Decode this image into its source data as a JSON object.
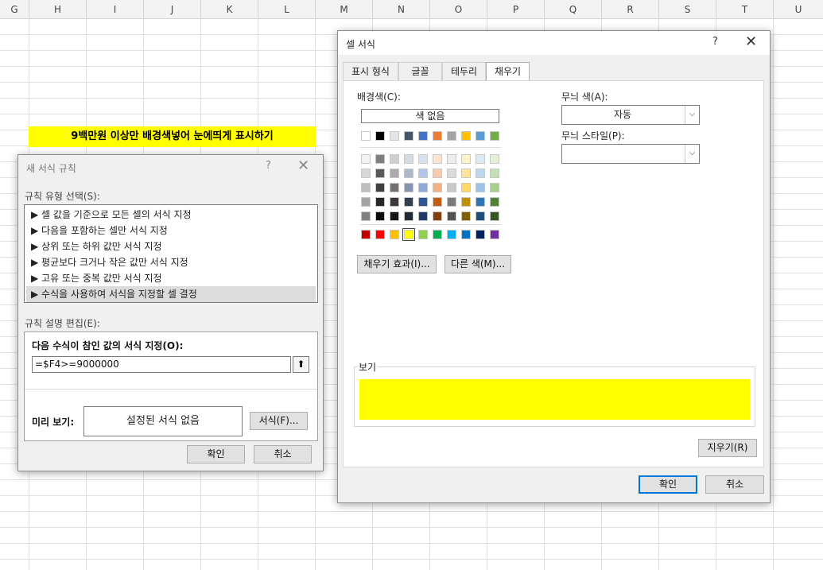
{
  "sheet": {
    "columns": [
      "G",
      "H",
      "I",
      "J",
      "K",
      "L",
      "M",
      "N",
      "O",
      "P",
      "Q",
      "R",
      "S",
      "T",
      "U"
    ],
    "banner_text": "9백만원 이상만 배경색넣어 눈에띄게 표시하기",
    "banner_color": "#ffff00"
  },
  "rule_dialog": {
    "title": "새 서식 규칙",
    "help": "?",
    "close": "✕",
    "select_type_label": "규칙 유형 선택(S):",
    "rule_types": [
      "▶ 셀 값을 기준으로 모든 셀의 서식 지정",
      "▶ 다음을 포함하는 셀만 서식 지정",
      "▶ 상위 또는 하위 값만 서식 지정",
      "▶ 평균보다 크거나 작은 값만 서식 지정",
      "▶ 고유 또는 중복 값만 서식 지정",
      "▶ 수식을 사용하여 서식을 지정할 셀 결정"
    ],
    "edit_label": "규칙 설명 편집(E):",
    "formula_label": "다음 수식이 참인 값의 서식 지정(O):",
    "formula_value": "=$F4>=9000000",
    "upload_icon": "⬆",
    "preview_label": "미리 보기:",
    "preview_text": "설정된 서식 없음",
    "format_button": "서식(F)...",
    "ok": "확인",
    "cancel": "취소"
  },
  "format_dialog": {
    "title": "셀 서식",
    "help": "?",
    "close": "✕",
    "tabs": [
      "표시 형식",
      "글꼴",
      "테두리",
      "채우기"
    ],
    "active_tab": "채우기",
    "bg_color_label": "배경색(C):",
    "no_color": "색 없음",
    "theme_colors_top": [
      "#ffffff",
      "#000000",
      "#e7e6e6",
      "#44546a",
      "#4472c4",
      "#ed7d31",
      "#a5a5a5",
      "#ffc000",
      "#5b9bd5",
      "#70ad47"
    ],
    "theme_shades": [
      [
        "#f2f2f2",
        "#7f7f7f",
        "#d0cece",
        "#d6dce4",
        "#d9e2f3",
        "#fbe5d5",
        "#ededed",
        "#fff2cc",
        "#deebf6",
        "#e2efd9"
      ],
      [
        "#d8d8d8",
        "#595959",
        "#aeabab",
        "#adb9ca",
        "#b4c6e7",
        "#f7cbac",
        "#dbdbdb",
        "#fee599",
        "#bdd7ee",
        "#c5e0b3"
      ],
      [
        "#bfbfbf",
        "#3f3f3f",
        "#757070",
        "#8496b0",
        "#8eaadb",
        "#f4b183",
        "#c9c9c9",
        "#ffd965",
        "#9dc3e6",
        "#a8d08d"
      ],
      [
        "#a5a5a5",
        "#262626",
        "#3a3838",
        "#323f4f",
        "#2f5496",
        "#c55a11",
        "#7b7b7b",
        "#bf9000",
        "#2e75b5",
        "#538135"
      ],
      [
        "#7f7f7f",
        "#0c0c0c",
        "#171616",
        "#222a35",
        "#1f3864",
        "#833c0b",
        "#525252",
        "#7f6000",
        "#1e4e79",
        "#375623"
      ]
    ],
    "standard_colors": [
      "#c00000",
      "#ff0000",
      "#ffc000",
      "#ffff00",
      "#92d050",
      "#00b050",
      "#00b0f0",
      "#0070c0",
      "#002060",
      "#7030a0"
    ],
    "selected_standard_index": 3,
    "fill_effects_button": "채우기 효과(I)...",
    "more_colors_button": "다른 색(M)...",
    "pattern_color_label": "무늬 색(A):",
    "pattern_color_value": "자동",
    "pattern_style_label": "무늬 스타일(P):",
    "pattern_style_value": "",
    "sample_label": "보기",
    "sample_color": "#ffff00",
    "clear_button": "지우기(R)",
    "ok": "확인",
    "cancel": "취소"
  }
}
